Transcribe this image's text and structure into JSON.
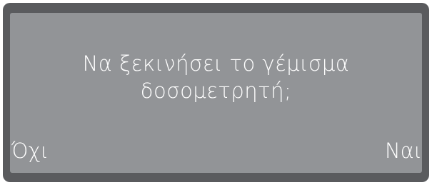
{
  "dialog": {
    "message_line1": "Να ξεκινήσει το γέμισμα",
    "message_line2": "δοσομετρητή;",
    "left_softkey": "Όχι",
    "right_softkey": "Ναι"
  },
  "colors": {
    "bezel": "#5a5b5e",
    "screen": "#929497",
    "text": "#ffffff"
  }
}
